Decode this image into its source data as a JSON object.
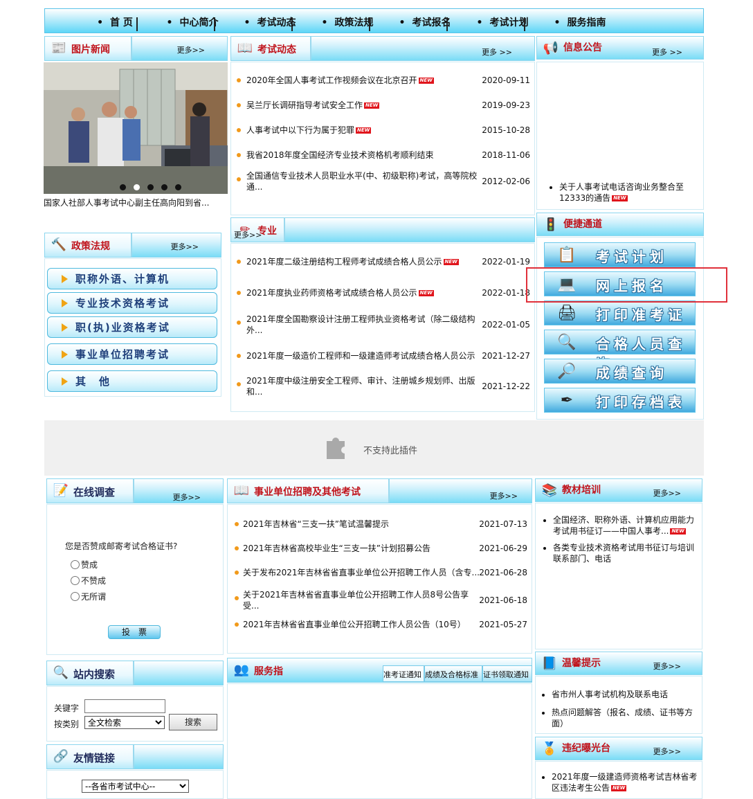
{
  "nav": [
    "首 页",
    "中心简介",
    "考试动态",
    "政策法规",
    "考试报名",
    "考试计划",
    "服务指南"
  ],
  "photo_news": {
    "title": "图片新闻",
    "more": "更多>>",
    "caption": "国家人社部人事考试中心副主任高向阳到省...",
    "slide_count": 5,
    "active_slide": 2
  },
  "exam_news": {
    "title": "考试动态",
    "more": "更多 >>",
    "items": [
      {
        "title": "2020年全国人事考试工作视频会议在北京召开",
        "date": "2020-09-11",
        "new": true
      },
      {
        "title": "吴兰厅长调研指导考试安全工作",
        "date": "2019-09-23",
        "new": true
      },
      {
        "title": "人事考试中以下行为属于犯罪",
        "date": "2015-10-28",
        "new": true
      },
      {
        "title": "我省2018年度全国经济专业技术资格机考顺利结束",
        "date": "2018-11-06",
        "new": false
      },
      {
        "title": "全国通信专业技术人员职业水平(中、初级职称)考试，高等院校通...",
        "date": "2012-02-06",
        "new": false
      }
    ]
  },
  "notice": {
    "title": "信息公告",
    "more": "更多 >>",
    "items": [
      {
        "title": "关于人事考试电话咨询业务整合至12333的通告",
        "new": true
      }
    ]
  },
  "policy": {
    "title": "政策法规",
    "more": "更多>>",
    "buttons": [
      "职称外语、计算机",
      "专业技术资格考试",
      "职(执)业资格考试",
      "事业单位招聘考试",
      "其　他"
    ]
  },
  "professional": {
    "title": "专业",
    "more": "更多>>",
    "items": [
      {
        "title": "2021年度二级注册结构工程师考试成绩合格人员公示",
        "date": "2022-01-19",
        "new": true
      },
      {
        "title": "2021年度执业药师资格考试成绩合格人员公示",
        "date": "2022-01-18",
        "new": true
      },
      {
        "title": "2021年度全国勘察设计注册工程师执业资格考试（除二级结构外...",
        "date": "2022-01-05",
        "new": false
      },
      {
        "title": "2021年度一级造价工程师和一级建造师考试成绩合格人员公示",
        "date": "2021-12-27",
        "new": false
      },
      {
        "title": "2021年度中级注册安全工程师、审计、注册城乡规划师、出版和...",
        "date": "2021-12-22",
        "new": false
      }
    ]
  },
  "quick": {
    "title": "便捷通道",
    "buttons": [
      {
        "label": "考试计划",
        "icon": "calendar-icon",
        "glyph": "📋"
      },
      {
        "label": "网上报名",
        "icon": "computer-icon",
        "glyph": "💻"
      },
      {
        "label": "打印准考证",
        "icon": "printer-icon",
        "glyph": "🖨"
      },
      {
        "label": "合格人员查询",
        "icon": "magnifier-icon",
        "glyph": "🔍"
      },
      {
        "label": "成绩查询",
        "icon": "magnifier-icon",
        "glyph": "🔎"
      },
      {
        "label": "打印存档表",
        "icon": "pen-icon",
        "glyph": "✒"
      }
    ]
  },
  "plugin": {
    "message": "不支持此插件"
  },
  "survey": {
    "title": "在线调查",
    "more": "更多>>",
    "question": "您是否赞成邮寄考试合格证书?",
    "options": [
      "赞成",
      "不赞成",
      "无所谓"
    ],
    "vote": "投　票"
  },
  "recruit": {
    "title": "事业单位招聘及其他考试",
    "more": "更多>>",
    "items": [
      {
        "title": "2021年吉林省“三支一扶”笔试温馨提示",
        "date": "2021-07-13"
      },
      {
        "title": "2021年吉林省高校毕业生“三支一扶”计划招募公告",
        "date": "2021-06-29"
      },
      {
        "title": "关于发布2021年吉林省省直事业单位公开招聘工作人员（含专...",
        "date": "2021-06-28"
      },
      {
        "title": "关于2021年吉林省省直事业单位公开招聘工作人员8号公告享受...",
        "date": "2021-06-18"
      },
      {
        "title": "2021年吉林省省直事业单位公开招聘工作人员公告（10号）",
        "date": "2021-05-27"
      }
    ]
  },
  "training": {
    "title": "教材培训",
    "more": "更多>>",
    "items": [
      {
        "title": "全国经济、职称外语、计算机应用能力考试用书征订——中国人事考...",
        "new": true
      },
      {
        "title": "各类专业技术资格考试用书征订与培训联系部门、电话",
        "new": false
      }
    ]
  },
  "search": {
    "title": "站内搜索",
    "keyword_label": "关键字",
    "category_label": "按类别",
    "category_value": "全文检索",
    "button": "搜索"
  },
  "service": {
    "title": "服务指南",
    "tabs": [
      "准考证通知",
      "成绩及合格标准",
      "证书领取通知"
    ]
  },
  "tips": {
    "title": "温馨提示",
    "more": "更多>>",
    "items": [
      "省市州人事考试机构及联系电话",
      "热点问题解答（报名、成绩、证书等方面）"
    ]
  },
  "links": {
    "title": "友情链接",
    "select_value": "--各省市考试中心--"
  },
  "violation": {
    "title": "违纪曝光台",
    "more": "更多>>",
    "items": [
      {
        "title": "2021年度一级建造师资格考试吉林省考区违法考生公告",
        "new": true
      }
    ]
  },
  "colors": {
    "accent": "#c0131b",
    "highlight_box": "#e0303a",
    "bullet": "#f19a1b"
  }
}
